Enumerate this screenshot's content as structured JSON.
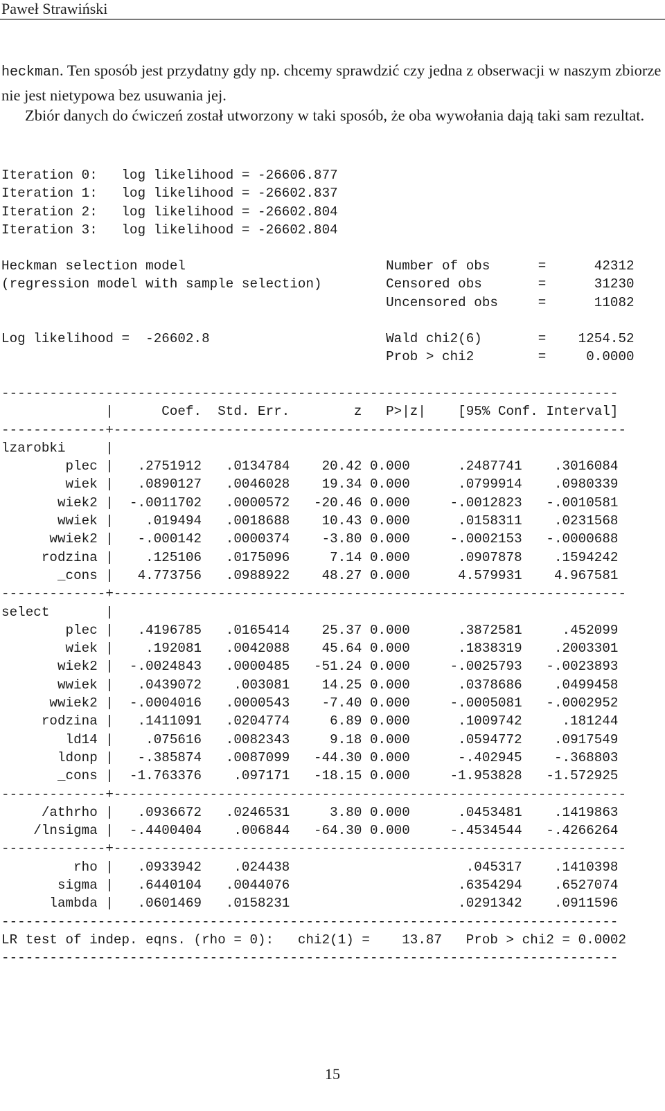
{
  "header": {
    "running_head": "Paweł Strawiński"
  },
  "body_text": {
    "paragraph1_code": "heckman",
    "paragraph1_rest": ". Ten sposób jest przydatny gdy np. chcemy sprawdzić czy jedna z obserwacji w naszym zbiorze nie jest nietypowa bez usuwania jej.",
    "paragraph2": "Zbiór danych do ćwiczeń został utworzony w taki sposób, że oba wywołania dają taki sam rezultat."
  },
  "iterations": [
    {
      "label": "Iteration 0:",
      "text": "log likelihood = -26606.877"
    },
    {
      "label": "Iteration 1:",
      "text": "log likelihood = -26602.837"
    },
    {
      "label": "Iteration 2:",
      "text": "log likelihood = -26602.804"
    },
    {
      "label": "Iteration 3:",
      "text": "log likelihood = -26602.804"
    }
  ],
  "model_header": {
    "title": "Heckman selection model",
    "subtitle": "(regression model with sample selection)",
    "loglik_label": "Log likelihood =",
    "loglik_value": "-26602.8",
    "stats": [
      {
        "label": "Number of obs",
        "eq": "=",
        "value": "42312"
      },
      {
        "label": "Censored obs",
        "eq": "=",
        "value": "31230"
      },
      {
        "label": "Uncensored obs",
        "eq": "=",
        "value": "11082"
      },
      {
        "label": "",
        "eq": "",
        "value": ""
      },
      {
        "label": "Wald chi2(6)",
        "eq": "=",
        "value": "1254.52"
      },
      {
        "label": "Prob > chi2",
        "eq": "=",
        "value": "0.0000"
      }
    ]
  },
  "table": {
    "columns": [
      "Coef.",
      "Std. Err.",
      "z",
      "P>|z|",
      "[95% Conf.",
      "Interval]"
    ],
    "dash_line": "-----------------------------------------------------------------------------",
    "sep_line_left": "-------------",
    "sep_line_plus": "+",
    "sep_line_right": "----------------------------------------------------------------",
    "bar": "|",
    "eq1": {
      "name": "lzarobki",
      "rows": [
        {
          "var": "plec",
          "coef": ".2751912",
          "se": ".0134784",
          "z": "20.42",
          "p": "0.000",
          "lo": ".2487741",
          "hi": ".3016084"
        },
        {
          "var": "wiek",
          "coef": ".0890127",
          "se": ".0046028",
          "z": "19.34",
          "p": "0.000",
          "lo": ".0799914",
          "hi": ".0980339"
        },
        {
          "var": "wiek2",
          "coef": "-.0011702",
          "se": ".0000572",
          "z": "-20.46",
          "p": "0.000",
          "lo": "-.0012823",
          "hi": "-.0010581"
        },
        {
          "var": "wwiek",
          "coef": ".019494",
          "se": ".0018688",
          "z": "10.43",
          "p": "0.000",
          "lo": ".0158311",
          "hi": ".0231568"
        },
        {
          "var": "wwiek2",
          "coef": "-.000142",
          "se": ".0000374",
          "z": "-3.80",
          "p": "0.000",
          "lo": "-.0002153",
          "hi": "-.0000688"
        },
        {
          "var": "rodzina",
          "coef": ".125106",
          "se": ".0175096",
          "z": "7.14",
          "p": "0.000",
          "lo": ".0907878",
          "hi": ".1594242"
        },
        {
          "var": "_cons",
          "coef": "4.773756",
          "se": ".0988922",
          "z": "48.27",
          "p": "0.000",
          "lo": "4.579931",
          "hi": "4.967581"
        }
      ]
    },
    "eq2": {
      "name": "select",
      "rows": [
        {
          "var": "plec",
          "coef": ".4196785",
          "se": ".0165414",
          "z": "25.37",
          "p": "0.000",
          "lo": ".3872581",
          "hi": ".452099"
        },
        {
          "var": "wiek",
          "coef": ".192081",
          "se": ".0042088",
          "z": "45.64",
          "p": "0.000",
          "lo": ".1838319",
          "hi": ".2003301"
        },
        {
          "var": "wiek2",
          "coef": "-.0024843",
          "se": ".0000485",
          "z": "-51.24",
          "p": "0.000",
          "lo": "-.0025793",
          "hi": "-.0023893"
        },
        {
          "var": "wwiek",
          "coef": ".0439072",
          "se": ".003081",
          "z": "14.25",
          "p": "0.000",
          "lo": ".0378686",
          "hi": ".0499458"
        },
        {
          "var": "wwiek2",
          "coef": "-.0004016",
          "se": ".0000543",
          "z": "-7.40",
          "p": "0.000",
          "lo": "-.0005081",
          "hi": "-.0002952"
        },
        {
          "var": "rodzina",
          "coef": ".1411091",
          "se": ".0204774",
          "z": "6.89",
          "p": "0.000",
          "lo": ".1009742",
          "hi": ".181244"
        },
        {
          "var": "ld14",
          "coef": ".075616",
          "se": ".0082343",
          "z": "9.18",
          "p": "0.000",
          "lo": ".0594772",
          "hi": ".0917549"
        },
        {
          "var": "ldonp",
          "coef": "-.385874",
          "se": ".0087099",
          "z": "-44.30",
          "p": "0.000",
          "lo": "-.402945",
          "hi": "-.368803"
        },
        {
          "var": "_cons",
          "coef": "-1.763376",
          "se": ".097171",
          "z": "-18.15",
          "p": "0.000",
          "lo": "-1.953828",
          "hi": "-1.572925"
        }
      ]
    },
    "aux": [
      {
        "var": "/athrho",
        "coef": ".0936672",
        "se": ".0246531",
        "z": "3.80",
        "p": "0.000",
        "lo": ".0453481",
        "hi": ".1419863"
      },
      {
        "var": "/lnsigma",
        "coef": "-.4400404",
        "se": ".006844",
        "z": "-64.30",
        "p": "0.000",
        "lo": "-.4534544",
        "hi": "-.4266264"
      }
    ],
    "derived": [
      {
        "var": "rho",
        "coef": ".0933942",
        "se": ".024438",
        "z": "",
        "p": "",
        "lo": ".045317",
        "hi": ".1410398"
      },
      {
        "var": "sigma",
        "coef": ".6440104",
        "se": ".0044076",
        "z": "",
        "p": "",
        "lo": ".6354294",
        "hi": ".6527074"
      },
      {
        "var": "lambda",
        "coef": ".0601469",
        "se": ".0158231",
        "z": "",
        "p": "",
        "lo": ".0291342",
        "hi": ".0911596"
      }
    ],
    "lr_test": "LR test of indep. eqns. (rho = 0):   chi2(1) =    13.87   Prob > chi2 = 0.0002"
  },
  "footer": {
    "page_number": "15"
  }
}
